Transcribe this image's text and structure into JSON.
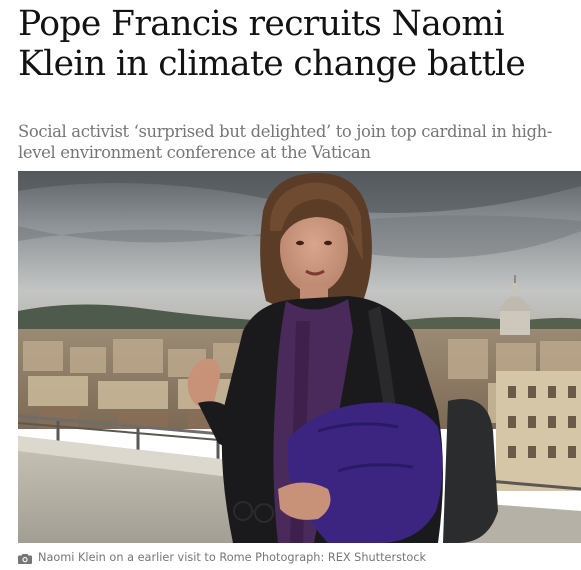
{
  "article": {
    "headline": "Pope Francis recruits Naomi Klein in climate change battle",
    "standfirst": "Social activist ‘surprised but delighted’ to join top cardinal in high-level environment conference at the Vatican",
    "caption": "Naomi Klein on a earlier visit to Rome Photograph: REX Shutterstock",
    "caption_icon": "camera-icon"
  }
}
